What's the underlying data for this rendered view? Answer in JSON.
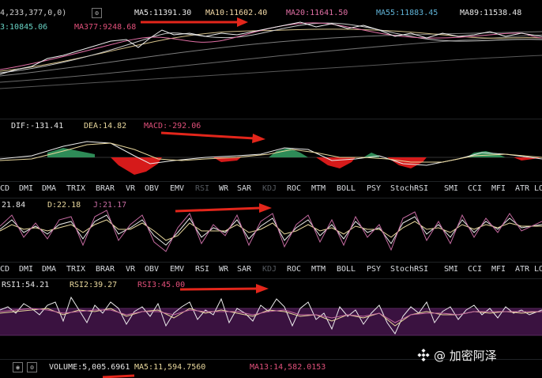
{
  "colors": {
    "background": "#000000",
    "macd_positive": "#2e8b57",
    "macd_negative": "#d61a1a",
    "rsi_band": "#3a1240",
    "annotation_arrow": "#e3261b"
  },
  "main_chart": {
    "header": {
      "ohlc_fragment": "4,233,377,0,0)",
      "ma5": "MA5:11391.30",
      "ma10": "MA10:11602.40",
      "ma20": "MA20:11641.50",
      "ma55": "MA55:11883.45",
      "ma89": "MA89:11538.48",
      "ma33": "3:10845.06",
      "ma377": "MA377:9248.68"
    }
  },
  "macd": {
    "header": {
      "dif": "DIF:-131.41",
      "dea": "DEA:14.82",
      "macd": "MACD:-292.06"
    }
  },
  "indicator_tabs": [
    "CD",
    "DMI",
    "DMA",
    "TRIX",
    "BRAR",
    "VR",
    "OBV",
    "EMV",
    "RSI",
    "WR",
    "SAR",
    "KDJ",
    "ROC",
    "MTM",
    "BOLL",
    "PSY",
    "StochRSI",
    "SMI",
    "CCI",
    "MFI",
    "ATR",
    "LO"
  ],
  "kdj": {
    "header": {
      "k": "21.84",
      "d": "D:22.18",
      "j": "J:21.17"
    }
  },
  "rsi": {
    "header": {
      "rsi1": "RSI1:54.21",
      "rsi2": "RSI2:39.27",
      "rsi3": "RSI3:45.00"
    }
  },
  "volume": {
    "header": {
      "volume": "VOLUME:5,005.6961",
      "ma5": "MA5:11,594.7560",
      "ma13": "MA13:14,582.0153"
    }
  },
  "watermark": {
    "text": "@ 加密阿泽"
  }
}
